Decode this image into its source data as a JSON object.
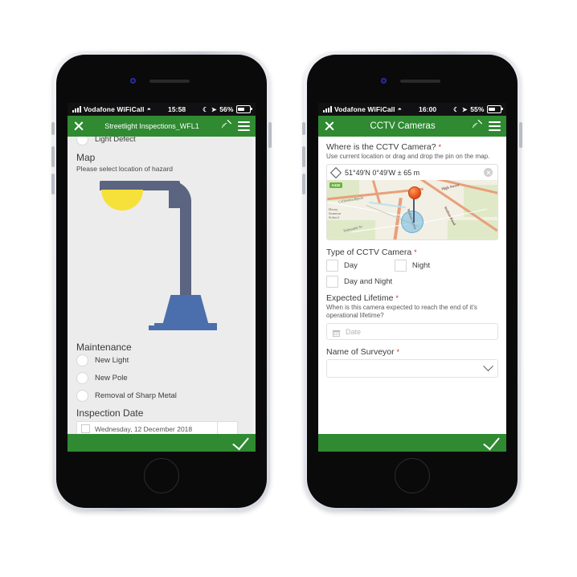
{
  "phones": [
    {
      "status_bar": {
        "carrier": "Vodafone WiFiCall",
        "wifi_icon": "wifi-icon",
        "time": "15:58",
        "moon_icon": "moon-icon",
        "location_icon": "location-arrow-icon",
        "battery_percent": "56%"
      },
      "app_bar": {
        "close_icon": "close-icon",
        "title": "Streetlight Inspections_WFL1",
        "satellite_icon": "satellite-icon",
        "menu_icon": "hamburger-menu-icon"
      },
      "form": {
        "top_option": "Light Defect",
        "map_section_title": "Map",
        "map_section_help": "Please select location of hazard",
        "maintenance_title": "Maintenance",
        "maintenance_options": [
          "New Light",
          "New Pole",
          "Removal of Sharp Metal"
        ],
        "inspection_date_title": "Inspection Date",
        "inspection_date_value": "Wednesday, 12 December 2018"
      },
      "submit_icon": "checkmark-icon"
    },
    {
      "status_bar": {
        "carrier": "Vodafone WiFiCall",
        "wifi_icon": "wifi-icon",
        "time": "16:00",
        "moon_icon": "moon-icon",
        "location_icon": "location-arrow-icon",
        "battery_percent": "55%"
      },
      "app_bar": {
        "close_icon": "close-icon",
        "title": "CCTV Cameras",
        "satellite_icon": "satellite-icon",
        "menu_icon": "hamburger-menu-icon"
      },
      "form": {
        "location_question": "Where is the CCTV Camera?",
        "location_required": "*",
        "location_help": "Use current location or drag and drop the pin on the map.",
        "coordinates": "51°49'N 0°49'W ± 65 m",
        "map": {
          "route_badge": "A418",
          "labels": [
            "High Street",
            "Walton Road",
            "Prebendal Av",
            "California Brook",
            "Henry Sammar School",
            "Walton Street"
          ]
        },
        "type_question": "Type of CCTV Camera",
        "type_required": "*",
        "type_options": [
          "Day",
          "Night",
          "Day and Night"
        ],
        "lifetime_question": "Expected Lifetime",
        "lifetime_required": "*",
        "lifetime_help": "When is this camera expected to reach the end of it's operational lifetime?",
        "date_placeholder": "Date",
        "surveyor_question": "Name of Surveyor",
        "surveyor_required": "*",
        "surveyor_value": ""
      },
      "submit_icon": "checkmark-icon"
    }
  ],
  "colors": {
    "brand_green": "#2f8a31",
    "required_red": "#c0392b",
    "pane_grey": "#ececec",
    "lamp_post": "#5b6480",
    "lamp_bulb": "#f6e03a",
    "lamp_base": "#4b6fad"
  }
}
